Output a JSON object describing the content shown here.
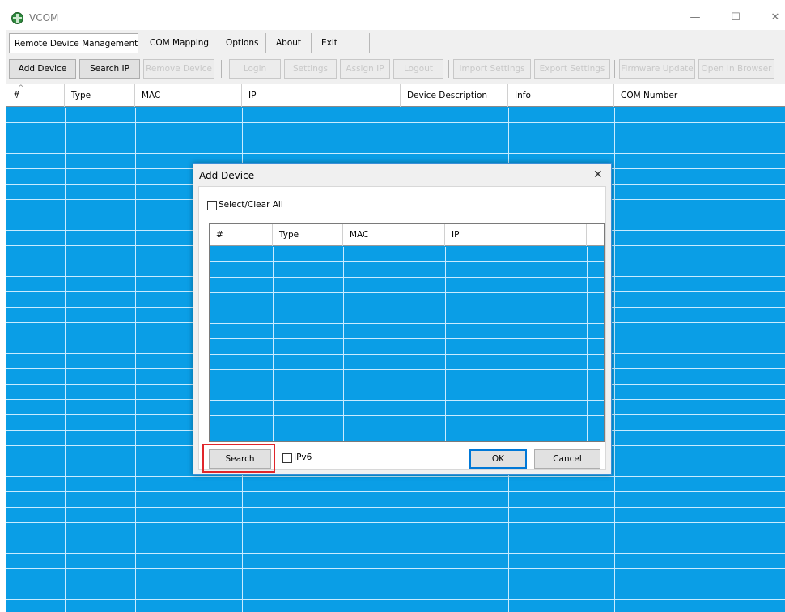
{
  "window": {
    "title": "VCOM",
    "controls": {
      "minimize": "—",
      "maximize": "☐",
      "close": "✕"
    }
  },
  "menu": {
    "items": [
      {
        "label": "Remote Device Management"
      },
      {
        "label": "COM Mapping"
      },
      {
        "label": "Options"
      },
      {
        "label": "About"
      },
      {
        "label": "Exit"
      }
    ]
  },
  "toolbar": {
    "buttons": [
      {
        "label": "Add Device",
        "enabled": true
      },
      {
        "label": "Search IP",
        "enabled": true
      },
      {
        "label": "Remove Device",
        "enabled": false
      },
      {
        "label": "Login",
        "enabled": false
      },
      {
        "label": "Settings",
        "enabled": false
      },
      {
        "label": "Assign IP",
        "enabled": false
      },
      {
        "label": "Logout",
        "enabled": false
      },
      {
        "label": "Import Settings",
        "enabled": false
      },
      {
        "label": "Export Settings",
        "enabled": false
      },
      {
        "label": "Firmware Update",
        "enabled": false
      },
      {
        "label": "Open In Browser",
        "enabled": false
      }
    ]
  },
  "grid": {
    "columns": [
      "#",
      "Type",
      "MAC",
      "IP",
      "Device Description",
      "Info",
      "COM Number"
    ],
    "sort_indicator": "^",
    "row_color": "#0a9ee6"
  },
  "dialog": {
    "title": "Add Device",
    "close": "✕",
    "select_all_label": "Select/Clear All",
    "columns": [
      "#",
      "Type",
      "MAC",
      "IP"
    ],
    "search_label": "Search",
    "ipv6_label": "IPv6",
    "ok_label": "OK",
    "cancel_label": "Cancel",
    "highlight_color": "#e0262b"
  }
}
